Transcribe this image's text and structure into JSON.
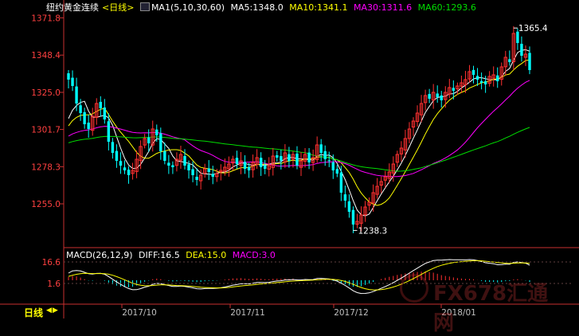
{
  "header": {
    "symbol": "纽约黄金连续",
    "period_tag": "<日线>",
    "ma_label": "MA1(5,10,30,60)",
    "ma5": "MA5:1348.0",
    "ma10": "MA10:1341.1",
    "ma30": "MA30:1311.6",
    "ma60": "MA60:1293.6"
  },
  "macd_header": {
    "label": "MACD(26,12,9)",
    "diff": "DIFF:16.5",
    "dea": "DEA:15.0",
    "macd": "MACD:3.0"
  },
  "bottom": {
    "period_tab": "日线",
    "arrows": "◀▶"
  },
  "watermark": {
    "text": "FX678汇通网"
  },
  "colors": {
    "up": "#ff3030",
    "down": "#00ffff",
    "ma5": "#ffffff",
    "ma10": "#ffff00",
    "ma30": "#ff00ff",
    "ma60": "#00dd00",
    "axis": "#c83030",
    "axis_text": "#ff4040",
    "x_text": "#c0c0c0"
  },
  "chart_data": {
    "type": "candlestick",
    "y_ticks": [
      "1371.8",
      "1348.4",
      "1325.0",
      "1301.7",
      "1278.3",
      "1255.0"
    ],
    "y_tick_values": [
      1371.8,
      1348.4,
      1325.0,
      1301.7,
      1278.3,
      1255.0
    ],
    "x_labels": [
      "2017/10",
      "2017/11",
      "2017/12",
      "2018/01"
    ],
    "annotations": [
      {
        "text": "1365.4",
        "value": 1365.4,
        "marker": "high"
      },
      {
        "text": "1238.3",
        "value": 1238.3,
        "marker": "low"
      }
    ],
    "macd_ticks": [
      "16.6",
      "1.6"
    ],
    "macd_tick_values": [
      16.6,
      1.6
    ],
    "closes": [
      1333,
      1329,
      1318,
      1312,
      1305,
      1302,
      1310,
      1318,
      1315,
      1308,
      1294,
      1287,
      1282,
      1279,
      1276,
      1273,
      1276,
      1283,
      1291,
      1296,
      1293,
      1302,
      1298,
      1288,
      1282,
      1279,
      1278,
      1283,
      1286,
      1279,
      1276,
      1273,
      1270,
      1273,
      1277,
      1275,
      1272,
      1274,
      1276,
      1278,
      1280,
      1283,
      1280,
      1282,
      1277,
      1276,
      1281,
      1284,
      1278,
      1277,
      1279,
      1285,
      1284,
      1282,
      1287,
      1282,
      1286,
      1279,
      1282,
      1286,
      1281,
      1284,
      1292,
      1287,
      1283,
      1282,
      1276,
      1274,
      1262,
      1257,
      1250,
      1242,
      1244,
      1248,
      1253,
      1256,
      1262,
      1266,
      1269,
      1272,
      1275,
      1280,
      1286,
      1290,
      1296,
      1302,
      1307,
      1312,
      1318,
      1323,
      1321,
      1325,
      1322,
      1320,
      1325,
      1328,
      1326,
      1329,
      1331,
      1333,
      1338,
      1336,
      1333,
      1331,
      1330,
      1335,
      1336,
      1332,
      1341,
      1347,
      1344,
      1362,
      1356,
      1348,
      1349,
      1339
    ],
    "ma5_final": 1348.0,
    "ma10_final": 1341.1,
    "ma30_final": 1311.6,
    "ma60_final": 1293.6
  }
}
